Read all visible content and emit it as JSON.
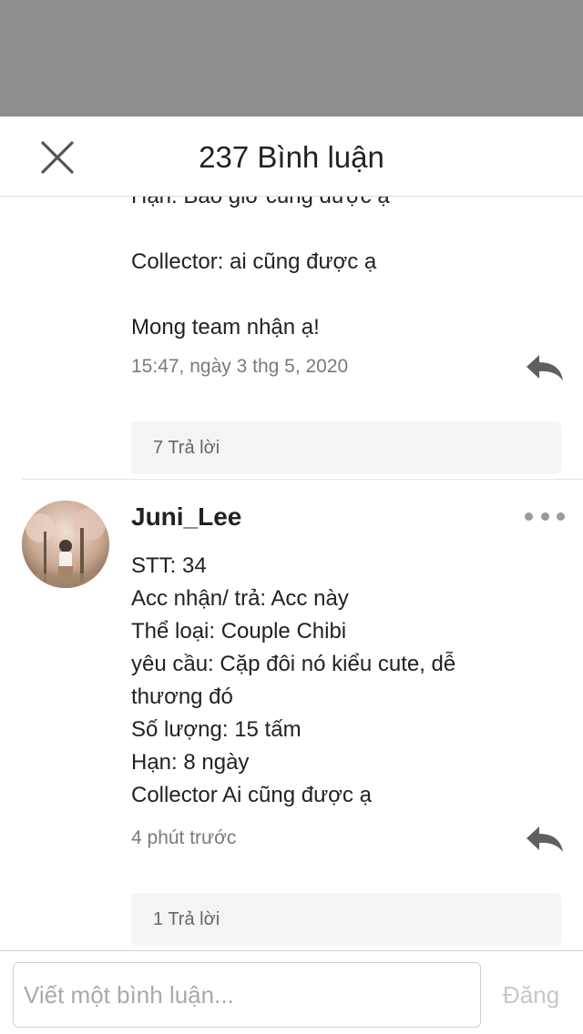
{
  "header": {
    "title": "237 Bình luận"
  },
  "comments": [
    {
      "body_lines": [
        "Hạn: Bao giờ cũng được ạ",
        "",
        "Collector: ai cũng được ạ",
        "",
        "Mong team nhận ạ!"
      ],
      "timestamp": "15:47, ngày 3 thg 5, 2020",
      "replies_label": "7 Trả lời"
    },
    {
      "username": "Juni_Lee",
      "avatar": "user-avatar-photo",
      "body_lines": [
        "STT: 34",
        "Acc nhận/ trả: Acc này",
        "Thể loại: Couple Chibi",
        "yêu cầu: Cặp đôi nó kiểu cute, dễ",
        "thương đó",
        "Số lượng: 15 tấm",
        "Hạn: 8 ngày",
        "Collector Ai cũng được ạ"
      ],
      "timestamp": "4 phút trước",
      "replies_label": "1 Trả lời"
    }
  ],
  "composer": {
    "placeholder": "Viết một bình luận...",
    "post_label": "Đăng"
  },
  "icons": {
    "close": "close-icon",
    "reply": "reply-arrow-icon",
    "more": "more-dots-icon"
  }
}
